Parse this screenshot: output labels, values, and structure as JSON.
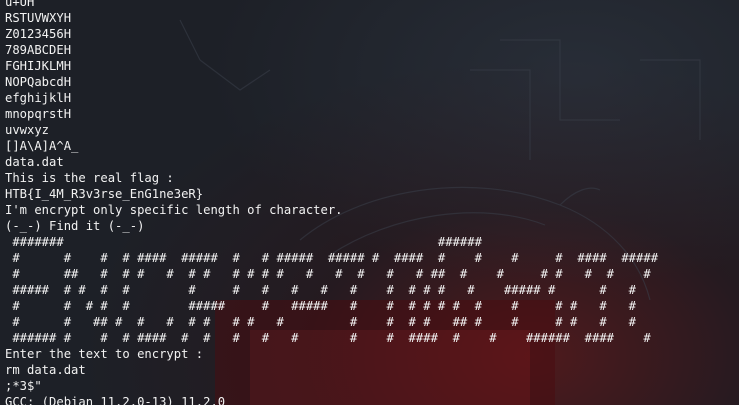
{
  "terminal": {
    "lines": [
      "u+UH",
      "RSTUVWXYH",
      "Z0123456H",
      "789ABCDEH",
      "FGHIJKLMH",
      "NOPQabcdH",
      "efghijklH",
      "mnopqrstH",
      "uvwxyz",
      "[]A\\A]A^A_",
      "data.dat",
      "This is the real flag :",
      "HTB{I_4M_R3v3rse_EnG1ne3eR}",
      "I'm encrypt only specific length of character.",
      "(-_-) Find it (-_-)"
    ],
    "banner": [
      " #######                                                   ######",
      " #      #    #  # ####  #####  #   # #####  ##### #  ####  #    #    #     #  ####  #####",
      " #      ##   #  # #   #  # #   # # # #   #   #  #   #   # ##  #    #     # #   #  #    #",
      " #####  # #  #  #        #     #   #   #   #   #    #  # # #   #    ##### #      #   #",
      " #      #  # #  #        #####     #   #####   #    #  # # # #  #    #     # #   #   #",
      " #      #   ## #  #   #  # #   # #   #         #    #  # #   ## #    #     # #   #   #",
      " ###### #    #  # ####  #  #   #   #   #       #    #  ####  #    #    ######  ####    #"
    ],
    "after_lines": [
      "Enter the text to encrypt :",
      "rm data.dat",
      ";*3$\"",
      "GCC: (Debian 11.2.0-13) 11.2.0"
    ]
  },
  "colors": {
    "background": "#1d2027",
    "text": "#f2f2f2",
    "wallpaper_red": "#7a1416"
  }
}
